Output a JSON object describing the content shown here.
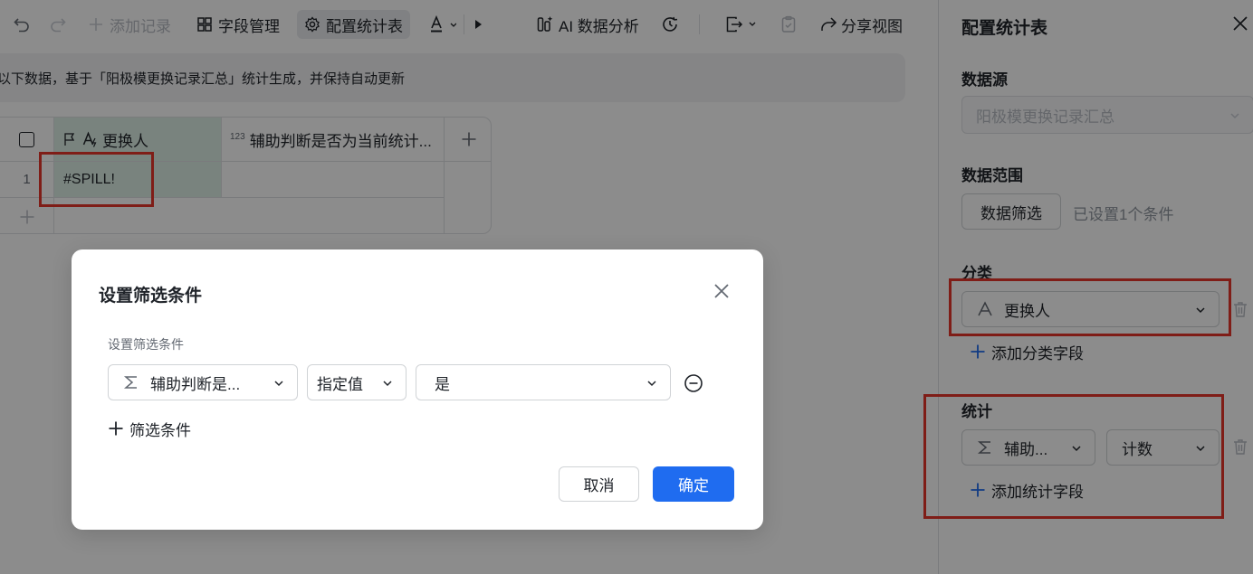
{
  "toolbar": {
    "add_record": "添加记录",
    "field_manage": "字段管理",
    "config_stats": "配置统计表",
    "ai_analysis": "AI 数据分析",
    "share_view": "分享视图"
  },
  "banner": {
    "text": "以下数据，基于「阳极模更换记录汇总」统计生成，并保持自动更新"
  },
  "grid": {
    "col1_header": "更换人",
    "col2_header": "辅助判断是否为当前统计...",
    "row_number": "1",
    "cell_value": "#SPILL!"
  },
  "dialog": {
    "title": "设置筛选条件",
    "subtitle": "设置筛选条件",
    "field_select": "辅助判断是...",
    "operator_select": "指定值",
    "value_select": "是",
    "add_condition": "筛选条件",
    "cancel": "取消",
    "confirm": "确定"
  },
  "panel": {
    "title": "配置统计表",
    "data_source_label": "数据源",
    "data_source_value": "阳极模更换记录汇总",
    "data_range_label": "数据范围",
    "filter_button": "数据筛选",
    "filter_note": "已设置1个条件",
    "category_label": "分类",
    "category_field": "更换人",
    "add_category": "添加分类字段",
    "stats_label": "统计",
    "stats_field": "辅助...",
    "stats_method": "计数",
    "add_stats": "添加统计字段"
  },
  "colors": {
    "primary": "#1f6cf0",
    "highlight_box": "#e8352b",
    "selected_column": "#ddefe6"
  }
}
